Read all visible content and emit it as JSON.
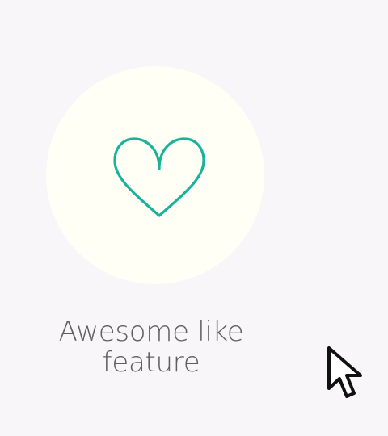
{
  "feature": {
    "title_line_1": "Awesome like",
    "title_line_2": "feature",
    "icon": "heart-icon",
    "accent_color": "#19b29a"
  },
  "cursor": {
    "icon": "mouse-pointer-icon"
  }
}
